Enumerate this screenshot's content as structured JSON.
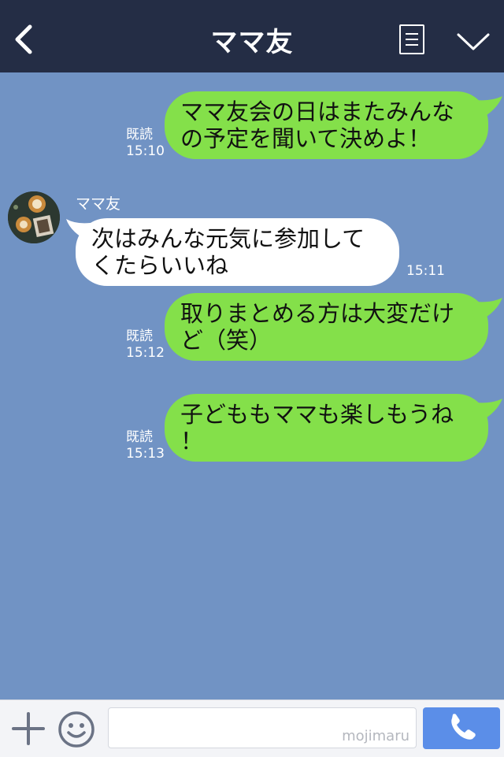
{
  "header": {
    "title": "ママ友"
  },
  "messages": [
    {
      "type": "sent",
      "lines": [
        "ママ友会の日はまたみんな",
        "の予定を聞いて決めよ！"
      ],
      "read": "既読",
      "time": "15:10"
    },
    {
      "type": "received",
      "sender": "ママ友",
      "lines": [
        "次はみんな元気に参加して",
        "くたらいいね"
      ],
      "time": "15:11"
    },
    {
      "type": "sent",
      "lines": [
        "取りまとめる方は大変だけ",
        "ど（笑）"
      ],
      "read": "既読",
      "time": "15:12"
    },
    {
      "type": "sent",
      "lines": [
        "子どももママも楽しもうね",
        "！"
      ],
      "read": "既読",
      "time": "15:13"
    }
  ],
  "input": {
    "value": "",
    "watermark": "mojimaru"
  },
  "colors": {
    "header_bg": "#242d45",
    "chat_bg": "#7193c4",
    "sent_bubble": "#84e04a",
    "received_bubble": "#ffffff",
    "call_button": "#5b8ee8"
  },
  "icons": [
    "back-arrow-icon",
    "menu-list-icon",
    "chevron-down-icon",
    "plus-icon",
    "emoji-icon",
    "phone-icon"
  ]
}
